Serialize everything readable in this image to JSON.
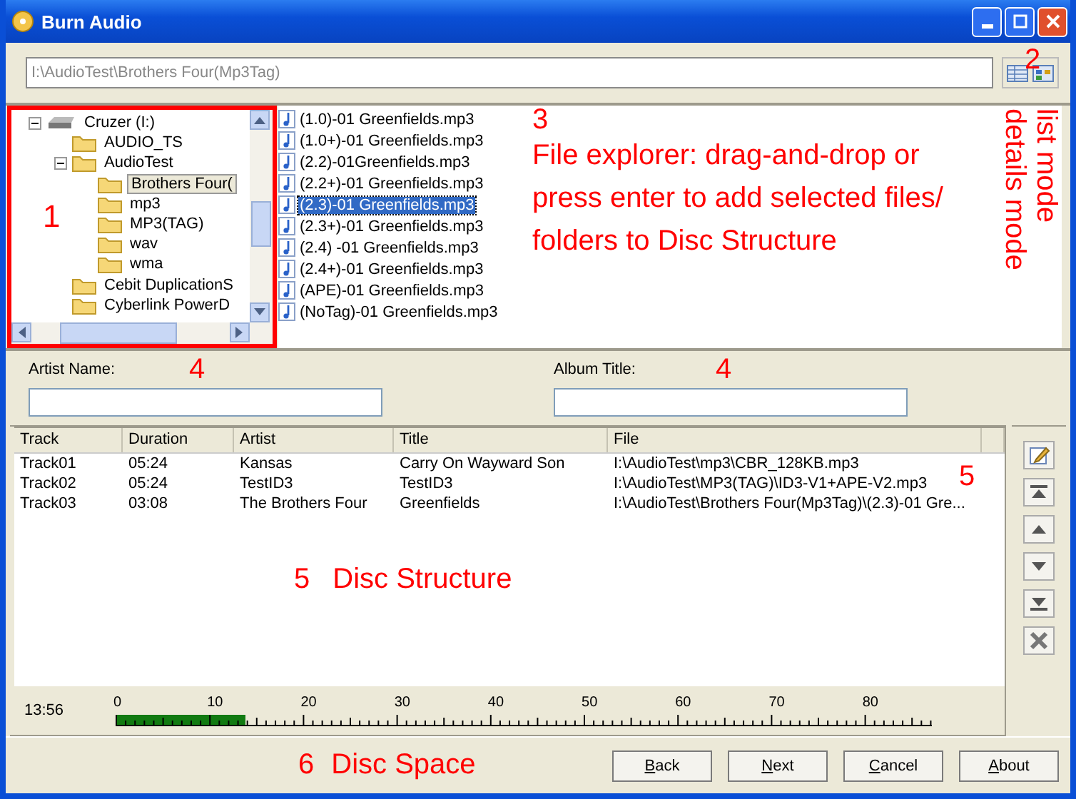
{
  "window": {
    "title": "Burn Audio"
  },
  "path_field": {
    "value": "I:\\AudioTest\\Brothers Four(Mp3Tag)"
  },
  "view_mode": {
    "annotation": "2",
    "notes": [
      "list mode",
      "details mode"
    ]
  },
  "tree": {
    "annotation": "1",
    "items": [
      {
        "label": "Cruzer (I:)",
        "kind": "drive",
        "expanded": true,
        "selected": false,
        "children": [
          {
            "label": "AUDIO_TS",
            "kind": "folder",
            "selected": false
          },
          {
            "label": "AudioTest",
            "kind": "folder",
            "expanded": true,
            "selected": false,
            "children": [
              {
                "label": "Brothers Four(",
                "kind": "folder",
                "selected": true
              },
              {
                "label": "mp3",
                "kind": "folder",
                "selected": false
              },
              {
                "label": "MP3(TAG)",
                "kind": "folder",
                "selected": false
              },
              {
                "label": "wav",
                "kind": "folder",
                "selected": false
              },
              {
                "label": "wma",
                "kind": "folder",
                "selected": false
              }
            ]
          },
          {
            "label": "Cebit DuplicationS",
            "kind": "folder",
            "selected": false
          },
          {
            "label": "Cyberlink PowerD",
            "kind": "folder",
            "selected": false
          }
        ]
      }
    ]
  },
  "files": {
    "annotation_number": "3",
    "annotation": "File explorer: drag-and-drop or press enter to add selected files/ folders to Disc Structure",
    "items": [
      {
        "name": "(1.0)-01 Greenfields.mp3",
        "selected": false
      },
      {
        "name": "(1.0+)-01 Greenfields.mp3",
        "selected": false
      },
      {
        "name": "(2.2)-01Greenfields.mp3",
        "selected": false
      },
      {
        "name": "(2.2+)-01 Greenfields.mp3",
        "selected": false
      },
      {
        "name": "(2.3)-01 Greenfields.mp3",
        "selected": true
      },
      {
        "name": "(2.3+)-01 Greenfields.mp3",
        "selected": false
      },
      {
        "name": "(2.4) -01 Greenfields.mp3",
        "selected": false
      },
      {
        "name": "(2.4+)-01 Greenfields.mp3",
        "selected": false
      },
      {
        "name": "(APE)-01 Greenfields.mp3",
        "selected": false
      },
      {
        "name": "(NoTag)-01 Greenfields.mp3",
        "selected": false
      }
    ]
  },
  "artist_field": {
    "label": "Artist Name:",
    "annotation": "4"
  },
  "album_field": {
    "label": "Album Title:",
    "annotation": "4"
  },
  "disc_structure": {
    "annotation_number": "5",
    "annotation": "Disc Structure",
    "side_annotation": "5",
    "columns": [
      "Track",
      "Duration",
      "Artist",
      "Title",
      "File"
    ],
    "rows": [
      [
        "Track01",
        "05:24",
        "Kansas",
        "Carry On Wayward Son",
        "I:\\AudioTest\\mp3\\CBR_128KB.mp3"
      ],
      [
        "Track02",
        "05:24",
        "TestID3",
        "TestID3",
        "I:\\AudioTest\\MP3(TAG)\\ID3-V1+APE-V2.mp3"
      ],
      [
        "Track03",
        "03:08",
        "The Brothers Four",
        "Greenfields",
        "I:\\AudioTest\\Brothers Four(Mp3Tag)\\(2.3)-01 Gre..."
      ]
    ]
  },
  "disc_space": {
    "time": "13:56",
    "level": 0.16,
    "ticks": [
      "0",
      "10",
      "20",
      "30",
      "40",
      "50",
      "60",
      "70",
      "80"
    ],
    "annotation_number": "6",
    "annotation": "Disc Space"
  },
  "buttons": [
    "Back",
    "Next",
    "Cancel",
    "About"
  ]
}
